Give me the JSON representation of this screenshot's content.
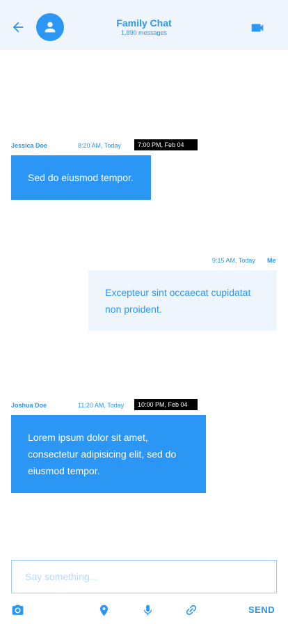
{
  "header": {
    "title": "Family Chat",
    "subtitle": "1,890 messages",
    "icons": {
      "back": "arrow-left-icon",
      "avatar": "person-icon",
      "video": "videocam-icon"
    }
  },
  "messages": [
    {
      "sender": "Jessica Doe",
      "time": "8:20 AM, Today",
      "tooltip": "7:00 PM, Feb 04",
      "text": "Sed do eiusmod tempor.",
      "direction": "incoming"
    },
    {
      "sender": "Me",
      "time": "9:15 AM, Today",
      "text": "Excepteur sint occaecat cupidatat non proident.",
      "direction": "outgoing"
    },
    {
      "sender": "Joshua Doe",
      "time": "11:20 AM, Today",
      "tooltip": "10:00 PM, Feb 04",
      "text": "Lorem ipsum dolor sit amet, consectetur adipisicing elit, sed do eiusmod tempor.",
      "direction": "incoming"
    }
  ],
  "composer": {
    "placeholder": "Say something...",
    "value": "",
    "send_label": "SEND",
    "tools": [
      "camera-icon",
      "location-pin-icon",
      "microphone-icon",
      "link-icon"
    ]
  },
  "colors": {
    "accent": "#2B96F3",
    "header_bg": "#EEF5FD",
    "outgoing_bg": "#EEF5FD",
    "tooltip_bg": "#000000"
  }
}
